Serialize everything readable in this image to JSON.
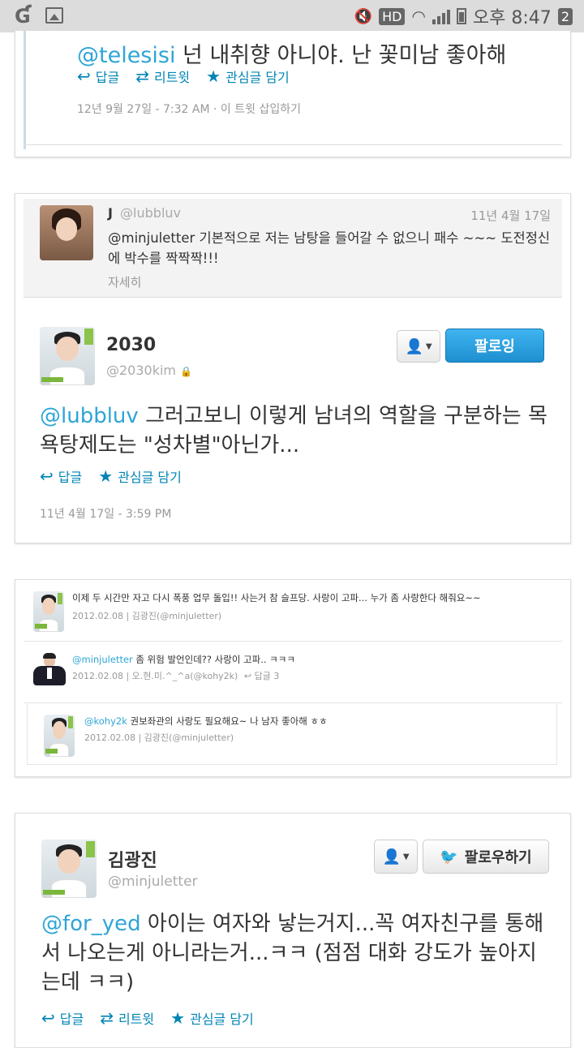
{
  "status_bar": {
    "left_icon": "g-logo-icon",
    "network_label": "HD",
    "time": "오후 8:47",
    "notification_count": "2"
  },
  "tweet1": {
    "mention": "@telesisi",
    "text": " 넌 내취향 아니야. 난 꽃미남 좋아해",
    "reply": "답글",
    "retweet": "리트윗",
    "favorite": "관심글 담기",
    "timestamp": "12년 9월 27일 - 7:32 AM",
    "embed": "· 이 트윗 삽입하기"
  },
  "tweet2": {
    "quoted": {
      "name": "J",
      "handle": "@lubbluv",
      "date": "11년 4월 17일",
      "text": "@minjuletter 기본적으로 저는 남탕을 들어갈 수 없으니 패수 ~~~ 도전정신에 박수를 짝짝짝!!!",
      "more": "자세히"
    },
    "author_name": "2030",
    "author_handle": "@2030kim",
    "follow_label": "팔로잉",
    "mention": "@lubbluv",
    "text": " 그러고보니 이렇게 남녀의 역할을 구분하는 목욕탕제도는 \"성차별\"아닌가...",
    "reply": "답글",
    "favorite": "관심글 담기",
    "timestamp": "11년 4월 17일 - 3:59 PM"
  },
  "thread": {
    "items": [
      {
        "text": "이제 두 시간만 자고 다시 폭풍 업무 돌입!! 사는거 참 슬프당. 사랑이 고파... 누가 좀 사랑한다 해줘요~~",
        "meta": "2012.02.08 | 김광진(@minjuletter)"
      },
      {
        "mention": "@minjuletter",
        "text": " 좀 위험 발언인데?? 사랑이 고파.. ㅋㅋㅋ",
        "meta": "2012.02.08 | 오.현.미.^_^a(@kohy2k)",
        "reply": "답글 3"
      },
      {
        "mention": "@kohy2k",
        "text": " 권보좌관의 사랑도 필요해요~ 나 남자 좋아해 ㅎㅎ",
        "meta": "2012.02.08 | 김광진(@minjuletter)"
      }
    ]
  },
  "tweet4": {
    "author_name": "김광진",
    "author_handle": "@minjuletter",
    "follow_label": "팔로우하기",
    "mention": "@for_yed",
    "text": " 아이는 여자와 낳는거지...꼭 여자친구를 통해서 나오는게 아니라는거...ㅋㅋ (점점 대화 강도가 높아지는데 ㅋㅋ)",
    "reply": "답글",
    "retweet": "리트윗",
    "favorite": "관심글 담기"
  },
  "colors": {
    "link": "#0084b4",
    "mention": "#2fa5d6",
    "follow_blue": "#1e8fd0"
  }
}
